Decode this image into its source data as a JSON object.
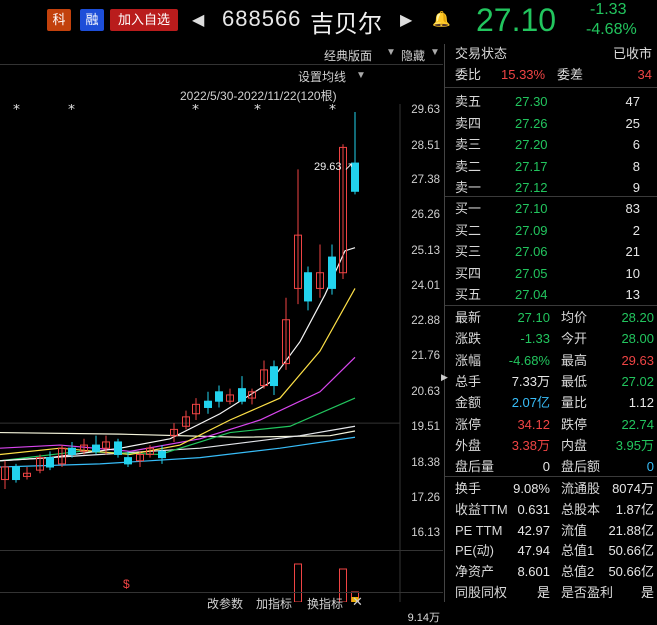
{
  "header": {
    "tag_ke": "科",
    "tag_rong": "融",
    "add_watch": "加入自选",
    "code": "688566",
    "name": "吉贝尔",
    "price": "27.10",
    "change": "-1.33",
    "change_pct": "-4.68%",
    "colors": {
      "ke": "#c2410c",
      "rong": "#1d4ed8",
      "add": "#b91c1c",
      "down": "#22c55e"
    }
  },
  "chart": {
    "toolbar": {
      "classic": "经典版面",
      "hide": "隐藏",
      "ma_setting": "设置均线"
    },
    "range_label": "2022/5/30-2022/11/22(120根)",
    "peak_label": "29.63",
    "y_ticks": [
      "29.63",
      "28.51",
      "27.38",
      "26.26",
      "25.13",
      "24.01",
      "22.88",
      "21.76",
      "20.63",
      "19.51",
      "18.38",
      "17.26",
      "16.13"
    ],
    "bottom_toolbar": {
      "change_params": "改参数",
      "add_indicator": "加指标",
      "switch_indicator": "换指标"
    },
    "vol_label": "9.14万",
    "dollar_mark": "$"
  },
  "panel": {
    "trade_status_label": "交易状态",
    "trade_status_value": "已收市",
    "ratio_label": "委比",
    "ratio_value": "15.33%",
    "diff_label": "委差",
    "diff_value": "34",
    "sells": [
      {
        "label": "卖五",
        "price": "27.30",
        "vol": "47"
      },
      {
        "label": "卖四",
        "price": "27.26",
        "vol": "25"
      },
      {
        "label": "卖三",
        "price": "27.20",
        "vol": "6"
      },
      {
        "label": "卖二",
        "price": "27.17",
        "vol": "8"
      },
      {
        "label": "卖一",
        "price": "27.12",
        "vol": "9"
      }
    ],
    "buys": [
      {
        "label": "买一",
        "price": "27.10",
        "vol": "83"
      },
      {
        "label": "买二",
        "price": "27.09",
        "vol": "2"
      },
      {
        "label": "买三",
        "price": "27.06",
        "vol": "21"
      },
      {
        "label": "买四",
        "price": "27.05",
        "vol": "10"
      },
      {
        "label": "买五",
        "price": "27.04",
        "vol": "13"
      }
    ],
    "stats": [
      {
        "l1": "最新",
        "v1": "27.10",
        "c1": "green",
        "l2": "均价",
        "v2": "28.20",
        "c2": "green"
      },
      {
        "l1": "涨跌",
        "v1": "-1.33",
        "c1": "green",
        "l2": "今开",
        "v2": "28.00",
        "c2": "green"
      },
      {
        "l1": "涨幅",
        "v1": "-4.68%",
        "c1": "green",
        "l2": "最高",
        "v2": "29.63",
        "c2": "red"
      },
      {
        "l1": "总手",
        "v1": "7.33万",
        "c1": "white",
        "l2": "最低",
        "v2": "27.02",
        "c2": "green"
      },
      {
        "l1": "金额",
        "v1": "2.07亿",
        "c1": "blue",
        "l2": "量比",
        "v2": "1.12",
        "c2": "white"
      },
      {
        "l1": "涨停",
        "v1": "34.12",
        "c1": "red",
        "l2": "跌停",
        "v2": "22.74",
        "c2": "green"
      },
      {
        "l1": "外盘",
        "v1": "3.38万",
        "c1": "red",
        "l2": "内盘",
        "v2": "3.95万",
        "c2": "green"
      },
      {
        "l1": "盘后量",
        "v1": "0",
        "c1": "white",
        "l2": "盘后额",
        "v2": "0",
        "c2": "blue"
      }
    ],
    "fund": [
      {
        "l1": "换手",
        "v1": "9.08%",
        "l2": "流通股",
        "v2": "8074万"
      },
      {
        "l1": "收益TTM",
        "v1": "0.631",
        "l2": "总股本",
        "v2": "1.87亿"
      },
      {
        "l1": "PE TTM",
        "v1": "42.97",
        "l2": "流值",
        "v2": "21.88亿"
      },
      {
        "l1": "PE(动)",
        "v1": "47.94",
        "l2": "总值1",
        "v2": "50.66亿"
      },
      {
        "l1": "净资产",
        "v1": "8.601",
        "l2": "总值2",
        "v2": "50.66亿"
      },
      {
        "l1": "同股同权",
        "v1": "是",
        "l2": "是否盈利",
        "v2": "是"
      }
    ]
  }
}
